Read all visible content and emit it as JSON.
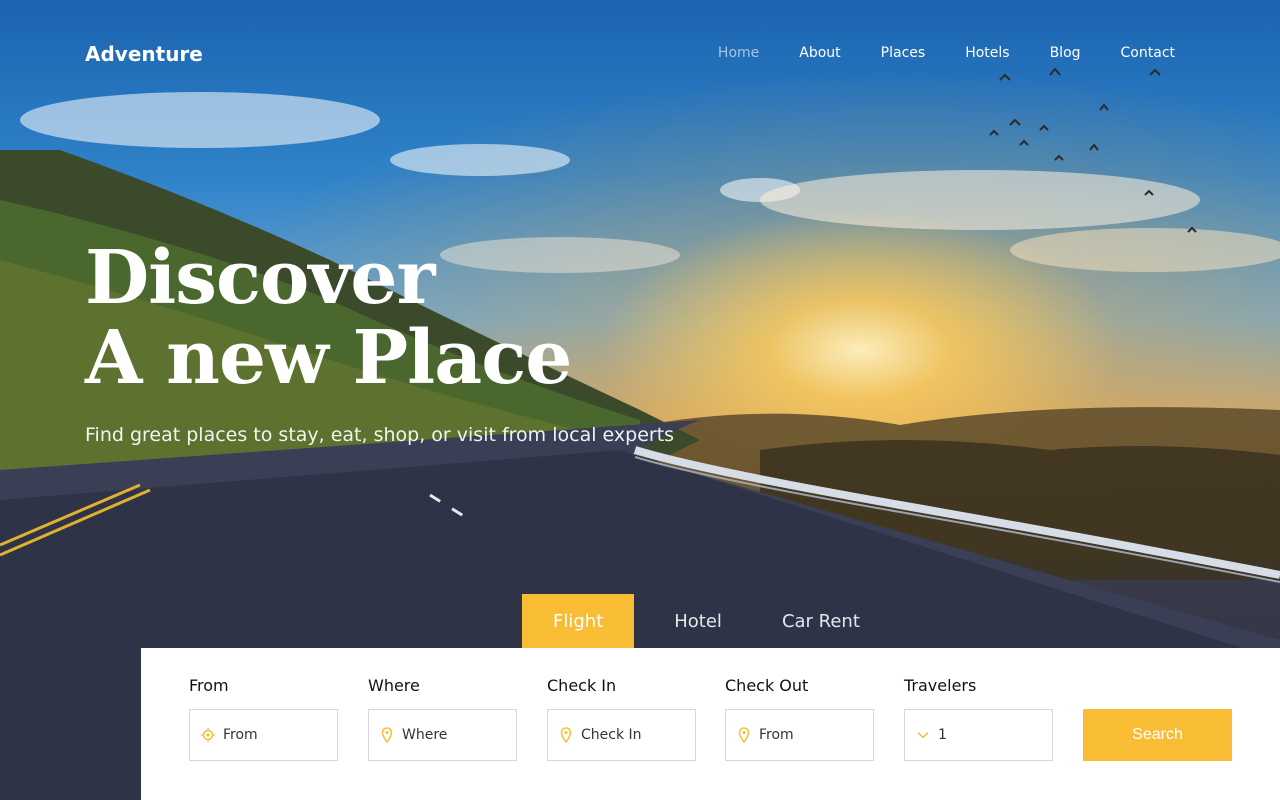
{
  "brand": {
    "name": "Adventure"
  },
  "nav": {
    "items": [
      "Home",
      "About",
      "Places",
      "Hotels",
      "Blog",
      "Contact"
    ],
    "active": "Home"
  },
  "hero": {
    "headline_line1": "Discover",
    "headline_line2": "A new Place",
    "subtitle": "Find great places to stay, eat, shop, or visit from local experts"
  },
  "booking": {
    "tabs": [
      "Flight",
      "Hotel",
      "Car Rent"
    ],
    "active_tab": "Flight",
    "fields": [
      {
        "label": "From",
        "placeholder": "From",
        "icon": "target-icon"
      },
      {
        "label": "Where",
        "placeholder": "Where",
        "icon": "map-pin-icon"
      },
      {
        "label": "Check In",
        "placeholder": "Check In",
        "icon": "map-pin-icon"
      },
      {
        "label": "Check Out",
        "placeholder": "From",
        "icon": "map-pin-icon"
      },
      {
        "label": "Travelers",
        "value": "1",
        "icon": "chevron-down-icon"
      }
    ],
    "search_label": "Search"
  },
  "colors": {
    "accent": "#f8bd35",
    "white": "#ffffff"
  }
}
